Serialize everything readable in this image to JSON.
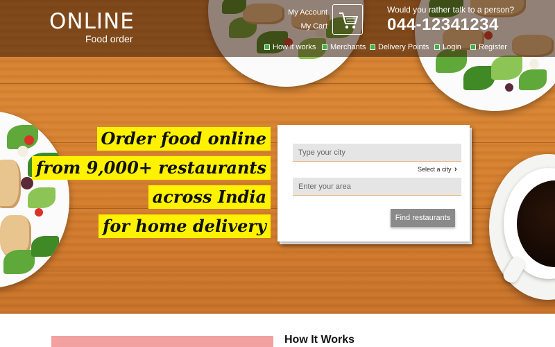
{
  "brand": {
    "title": "ONLINE",
    "subtitle": "Food order"
  },
  "account": {
    "my_account": "My Account",
    "my_cart": "My Cart",
    "cart_icon": "cart-icon"
  },
  "contact": {
    "prompt": "Would you rather talk to a person?",
    "phone": "044-12341234"
  },
  "nav": {
    "items": [
      {
        "label": "How it works"
      },
      {
        "label": "Merchants"
      },
      {
        "label": "Delivery Points"
      },
      {
        "label": "Login"
      },
      {
        "label": "Register"
      }
    ]
  },
  "headline": {
    "lines": [
      "Order food online",
      "from 9,000+ restaurants",
      "across India",
      "for home delivery"
    ]
  },
  "search_form": {
    "city_placeholder": "Type your city",
    "select_city": "Select a city",
    "area_placeholder": "Enter your area",
    "submit_label": "Find restaurants"
  },
  "section": {
    "how_it_works_title": "How It Works"
  },
  "colors": {
    "highlight": "#fff200",
    "nav_bullet": "#3fb34a",
    "button": "#8a8a8a",
    "pink_block": "#f3a0a0"
  }
}
